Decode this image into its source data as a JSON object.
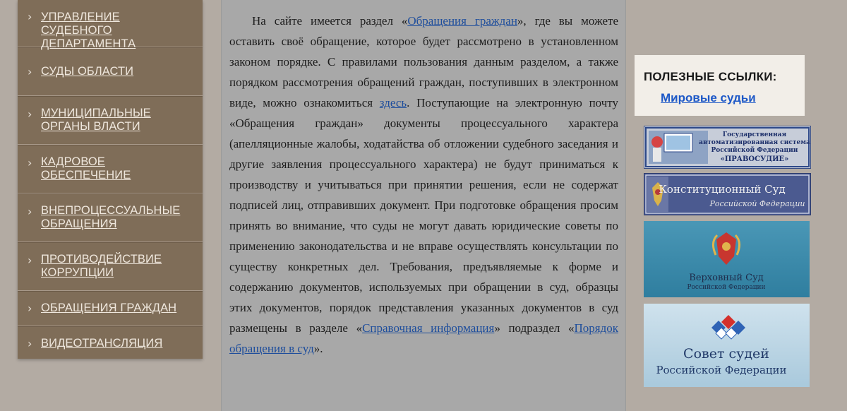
{
  "sidebar": {
    "items": [
      {
        "label_lines": [
          "УПРАВЛЕНИЕ",
          "СУДЕБНОГО",
          "ДЕПАРТАМЕНТА"
        ]
      },
      {
        "label_lines": [
          "СУДЫ ОБЛАСТИ"
        ]
      },
      {
        "label_lines": [
          "МУНИЦИПАЛЬНЫЕ",
          "ОРГАНЫ ВЛАСТИ"
        ]
      },
      {
        "label_lines": [
          "КАДРОВОЕ",
          "ОБЕСПЕЧЕНИЕ"
        ]
      },
      {
        "label_lines": [
          "ВНЕПРОЦЕССУАЛЬНЫЕ",
          "ОБРАЩЕНИЯ"
        ]
      },
      {
        "label_lines": [
          "ПРОТИВОДЕЙСТВИЕ",
          "КОРРУПЦИИ"
        ]
      },
      {
        "label_lines": [
          "ОБРАЩЕНИЯ ГРАЖДАН"
        ]
      },
      {
        "label_lines": [
          "ВИДЕОТРАНСЛЯЦИЯ"
        ]
      }
    ],
    "chevron": "›"
  },
  "content": {
    "t1": "На сайте имеется раздел «",
    "link1": "Обращения граждан",
    "t2": "», где вы можете оставить своё обращение, которое будет рассмотрено в установленном законом порядке. С правилами пользования данным разделом, а также порядком рассмотрения обращений граждан, поступивших в электронном виде, можно ознакомиться ",
    "link2": "здесь",
    "t3": ". Поступающие на электронную почту «Обращения граждан» документы процессуального характера (апелляционные жалобы, ходатайства об отложении судебного заседания и другие заявления процессуального характера) не будут приниматься к производству и учитываться при принятии решения, если не содержат подписей лиц, отправивших документ. При подготовке обращения просим принять во внимание, что суды не могут давать юридические советы по применению законодательства и не вправе осуществлять консультации по существу конкретных дел. Требования, предъявляемые к форме и содержанию документов, используемых при обращении в суд, образцы этих документов, порядок представления указанных документов в суд размещены в разделе «",
    "link3": "Справочная информация",
    "t4": "» подраздел «",
    "link4": "Порядок обращения в суд",
    "t5": "»."
  },
  "useful_links": {
    "title": "ПОЛЕЗНЫЕ ССЫЛКИ:",
    "items": [
      "Мировые судьи"
    ]
  },
  "banners": {
    "pravosudie": {
      "lines": [
        "Государственная",
        "автоматизированная система",
        "Российской Федерации",
        "«ПРАВОСУДИЕ»"
      ]
    },
    "ks": {
      "line1": "Конституционный Суд",
      "line2": "Российской Федерации"
    },
    "vs": {
      "line1": "Верховный Суд",
      "line2": "Российской Федерации"
    },
    "ss": {
      "line1": "Совет судей",
      "line2": "Российской Федерации"
    }
  },
  "colors": {
    "sidebar_bg": "#7f6d58",
    "content_bg": "#a8a8a8",
    "link": "#1d4d9c",
    "useful_link": "#1d58c7"
  }
}
